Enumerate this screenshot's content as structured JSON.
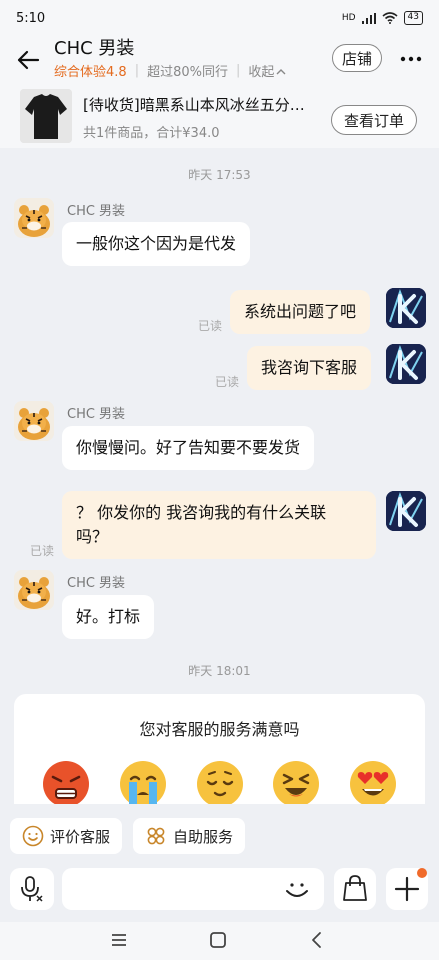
{
  "status": {
    "time": "5:10",
    "network": "HD",
    "battery": "43"
  },
  "header": {
    "shop_name": "CHC 男装",
    "score": "综合体验4.8",
    "rank": "超过80%同行",
    "collapse": "收起",
    "store_button": "店铺"
  },
  "order": {
    "title": "[待收货]暗黑系山本风冰丝五分…",
    "summary": "共1件商品，合计¥34.0",
    "button": "查看订单"
  },
  "messages": {
    "time1": "昨天 17:53",
    "m1_sender": "CHC 男装",
    "m1_text": "一般你这个因为是代发",
    "m2_text": "系统出问题了吧",
    "m2_read": "已读",
    "m3_text": "我咨询下客服",
    "m3_read": "已读",
    "m4_sender": "CHC 男装",
    "m4_text": "你慢慢问。好了告知要不要发货",
    "m5_line1": "？ 你发你的 我咨询我的有什么关联",
    "m5_line2": "吗？",
    "m5_read": "已读",
    "m6_sender": "CHC 男装",
    "m6_text": "好。打标",
    "time2": "昨天 18:01"
  },
  "rating": {
    "title": "您对客服的服务满意吗",
    "emojis": [
      "angry-face-icon",
      "crying-face-icon",
      "relieved-face-icon",
      "grinning-squint-face-icon",
      "heart-eyes-face-icon"
    ]
  },
  "quick_actions": {
    "evaluate": "评价客服",
    "self_service": "自助服务"
  },
  "input": {
    "placeholder": ""
  },
  "colors": {
    "accent": "#e46b1f",
    "bubble_out": "#fdf2e2",
    "bubble_in": "#ffffff",
    "background": "#eef0f4"
  }
}
